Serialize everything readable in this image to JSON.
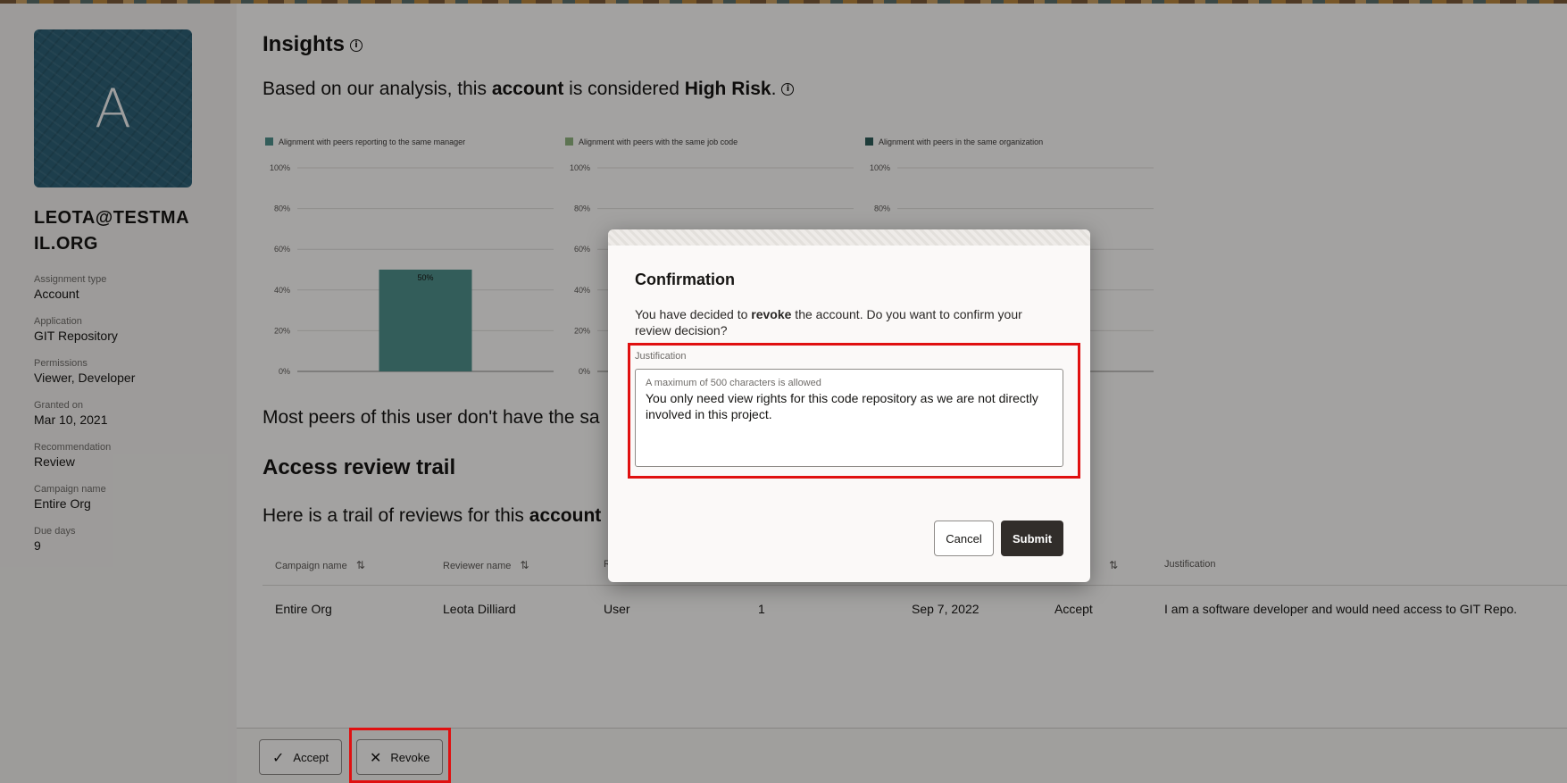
{
  "profile": {
    "avatar_letter": "A",
    "username": "LEOTA@TESTMAIL.ORG",
    "fields": [
      {
        "label": "Assignment type",
        "value": "Account"
      },
      {
        "label": "Application",
        "value": "GIT Repository"
      },
      {
        "label": "Permissions",
        "value": "Viewer, Developer"
      },
      {
        "label": "Granted on",
        "value": "Mar 10, 2021"
      },
      {
        "label": "Recommendation",
        "value": "Review"
      },
      {
        "label": "Campaign name",
        "value": "Entire Org"
      },
      {
        "label": "Due days",
        "value": "9"
      }
    ]
  },
  "insights": {
    "title": "Insights",
    "analysis_prefix": "Based on our analysis, this ",
    "analysis_entity": "account",
    "analysis_middle": " is considered ",
    "analysis_risk": "High Risk",
    "analysis_suffix": ".",
    "peers_text": "Most peers of this user don't have the sa"
  },
  "chart_data": [
    {
      "type": "bar",
      "legend": "Alignment with peers reporting to the same manager",
      "color": "#4f8f8a",
      "categories": [
        ""
      ],
      "values": [
        50
      ],
      "value_label": "50%",
      "ylim": [
        0,
        100
      ],
      "yticks": [
        "0%",
        "20%",
        "40%",
        "60%",
        "80%",
        "100%"
      ]
    },
    {
      "type": "bar",
      "legend": "Alignment with peers with the same job code",
      "color": "#8fb27f",
      "categories": [
        ""
      ],
      "values": [
        0
      ],
      "ylim": [
        0,
        100
      ],
      "yticks": [
        "0%",
        "20%",
        "40%",
        "60%",
        "80%",
        "100%"
      ]
    },
    {
      "type": "bar",
      "legend": "Alignment with peers in the same organization",
      "color": "#2f5c5a",
      "categories": [
        ""
      ],
      "values": [
        0
      ],
      "ylim": [
        0,
        100
      ],
      "yticks": [
        "0%",
        "20%",
        "40%",
        "60%",
        "80%",
        "100%"
      ]
    }
  ],
  "trail": {
    "title": "Access review trail",
    "desc_prefix": "Here is a trail of reviews for this ",
    "desc_entity": "account",
    "columns": [
      "Campaign name",
      "Reviewer name",
      "R",
      "",
      "",
      "",
      "Justification"
    ],
    "sort_icon": "⇅",
    "rows": [
      [
        "Entire Org",
        "Leota Dilliard",
        "User",
        "1",
        "Sep 7, 2022",
        "Accept",
        "I am a software developer and would need access to GIT Repo."
      ]
    ]
  },
  "actions": {
    "accept_label": "Accept",
    "revoke_label": "Revoke"
  },
  "modal": {
    "title": "Confirmation",
    "msg_prefix": "You have decided to ",
    "msg_action": "revoke",
    "msg_suffix": " the account. Do you want to confirm your review decision?",
    "justification_label": "Justification",
    "justification_hint": "A maximum of 500 characters is allowed",
    "justification_value": "You only need view rights for this code repository as we are not directly involved in this project.",
    "cancel_label": "Cancel",
    "submit_label": "Submit"
  }
}
